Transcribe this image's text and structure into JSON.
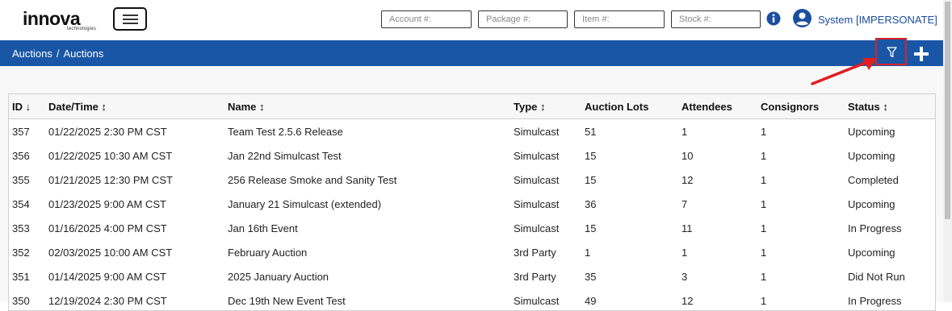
{
  "header": {
    "logo_text": "innova",
    "logo_subtext": "technologies",
    "search": {
      "account_placeholder": "Account #:",
      "package_placeholder": "Package #:",
      "item_placeholder": "Item #:",
      "stock_placeholder": "Stock #:"
    },
    "user_label": "System [IMPERSONATE]"
  },
  "breadcrumb": {
    "root": "Auctions",
    "separator": "/",
    "current": "Auctions"
  },
  "colors": {
    "brand_blue": "#1a56a6",
    "highlight_red": "#d8232a"
  },
  "table": {
    "columns": {
      "id": "ID ↓",
      "date": "Date/Time ↕",
      "name": "Name ↕",
      "type": "Type ↕",
      "lots": "Auction Lots",
      "attendees": "Attendees",
      "consignors": "Consignors",
      "status": "Status ↕"
    },
    "rows": [
      {
        "id": "357",
        "date": "01/22/2025 2:30 PM CST",
        "name": "Team Test 2.5.6 Release",
        "type": "Simulcast",
        "lots": "51",
        "attendees": "1",
        "consignors": "1",
        "status": "Upcoming"
      },
      {
        "id": "356",
        "date": "01/22/2025 10:30 AM CST",
        "name": "Jan 22nd Simulcast Test",
        "type": "Simulcast",
        "lots": "15",
        "attendees": "10",
        "consignors": "1",
        "status": "Upcoming"
      },
      {
        "id": "355",
        "date": "01/21/2025 12:30 PM CST",
        "name": "256 Release Smoke and Sanity Test",
        "type": "Simulcast",
        "lots": "15",
        "attendees": "12",
        "consignors": "1",
        "status": "Completed"
      },
      {
        "id": "354",
        "date": "01/23/2025 9:00 AM CST",
        "name": "January 21 Simulcast (extended)",
        "type": "Simulcast",
        "lots": "36",
        "attendees": "7",
        "consignors": "1",
        "status": "Upcoming"
      },
      {
        "id": "353",
        "date": "01/16/2025 4:00 PM CST",
        "name": "Jan 16th Event",
        "type": "Simulcast",
        "lots": "15",
        "attendees": "11",
        "consignors": "1",
        "status": "In Progress"
      },
      {
        "id": "352",
        "date": "02/03/2025 10:00 AM CST",
        "name": "February Auction",
        "type": "3rd Party",
        "lots": "1",
        "attendees": "1",
        "consignors": "1",
        "status": "Upcoming"
      },
      {
        "id": "351",
        "date": "01/14/2025 9:00 AM CST",
        "name": "2025 January Auction",
        "type": "3rd Party",
        "lots": "35",
        "attendees": "3",
        "consignors": "1",
        "status": "Did Not Run"
      },
      {
        "id": "350",
        "date": "12/19/2024 2:30 PM CST",
        "name": "Dec 19th New Event Test",
        "type": "Simulcast",
        "lots": "49",
        "attendees": "12",
        "consignors": "1",
        "status": "In Progress"
      }
    ]
  }
}
